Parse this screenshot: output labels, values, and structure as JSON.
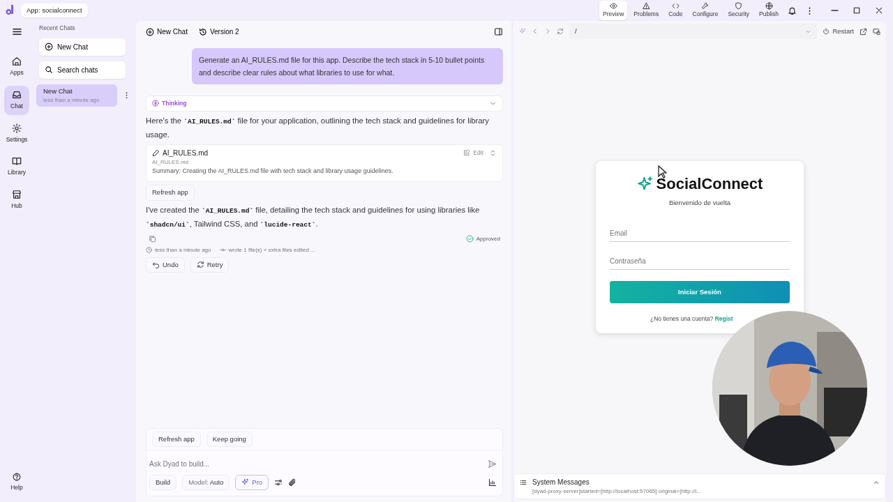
{
  "app_badge": "App: socialconnect",
  "top_tabs": [
    {
      "label": "Preview",
      "selected": true
    },
    {
      "label": "Problems",
      "selected": false
    },
    {
      "label": "Code",
      "selected": false
    },
    {
      "label": "Configure",
      "selected": false
    },
    {
      "label": "Security",
      "selected": false
    },
    {
      "label": "Publish",
      "selected": false
    }
  ],
  "nav": [
    {
      "label": "Apps",
      "selected": false
    },
    {
      "label": "Chat",
      "selected": true
    },
    {
      "label": "Settings",
      "selected": false
    },
    {
      "label": "Library",
      "selected": false
    },
    {
      "label": "Hub",
      "selected": false
    }
  ],
  "help": "Help",
  "recent": {
    "title": "Recent Chats",
    "new_chat": "New Chat",
    "search": "Search chats",
    "chats": [
      {
        "title": "New Chat",
        "time": "less than a minute ago",
        "selected": true
      }
    ]
  },
  "chat": {
    "new_chat": "New Chat",
    "version": "Version 2",
    "user_message": "Generate an AI_RULES.md file for this app. Describe the tech stack in 5-10 bullet points and describe clear rules about what libraries to use for what.",
    "thinking": "Thinking",
    "reply_1": [
      {
        "kind": "text",
        "text": "Here's the "
      },
      {
        "kind": "code",
        "text": "`AI_RULES.md`"
      },
      {
        "kind": "text",
        "text": " file for your application, outlining the tech stack and guidelines for library usage."
      }
    ],
    "file_card": {
      "title": "AI_RULES.md",
      "path": "AI_RULES.md",
      "summary": "Summary: Creating the AI_RULES.md file with tech stack and library usage guidelines.",
      "action": "Edit"
    },
    "refresh": "Refresh app",
    "reply_2": [
      {
        "kind": "text",
        "text": "I've created the "
      },
      {
        "kind": "code",
        "text": "`AI_RULES.md`"
      },
      {
        "kind": "text",
        "text": " file, detailing the tech stack and guidelines for using libraries like "
      },
      {
        "kind": "code",
        "text": "`shadcn/ui`"
      },
      {
        "kind": "text",
        "text": ", Tailwind CSS, and "
      },
      {
        "kind": "code",
        "text": "`lucide-react`"
      },
      {
        "kind": "text",
        "text": "."
      }
    ],
    "status": "Approved",
    "time": "less than a minute ago",
    "commit": "wrote 1 file(s) + extra files edited ...",
    "undo": "Undo",
    "retry": "Retry"
  },
  "composer": {
    "suggestions": [
      "Refresh app",
      "Keep going"
    ],
    "placeholder": "Ask Dyad to build...",
    "mode": "Build",
    "model_label": "Model:",
    "model": "Auto",
    "pro": "Pro"
  },
  "preview": {
    "path": "/",
    "restart": "Restart",
    "login": {
      "brand": "SocialConnect",
      "subtitle": "Bienvenido de vuelta",
      "email_placeholder": "Email",
      "password_placeholder": "Contraseña",
      "submit": "Iniciar Sesión",
      "signup_prompt": "¿No tienes una cuenta?",
      "signup_link": "Regist"
    }
  },
  "system": {
    "title": "System Messages",
    "message": "[dyad-proxy-server]started=[http://localhost:57065] original=[http://l..."
  }
}
